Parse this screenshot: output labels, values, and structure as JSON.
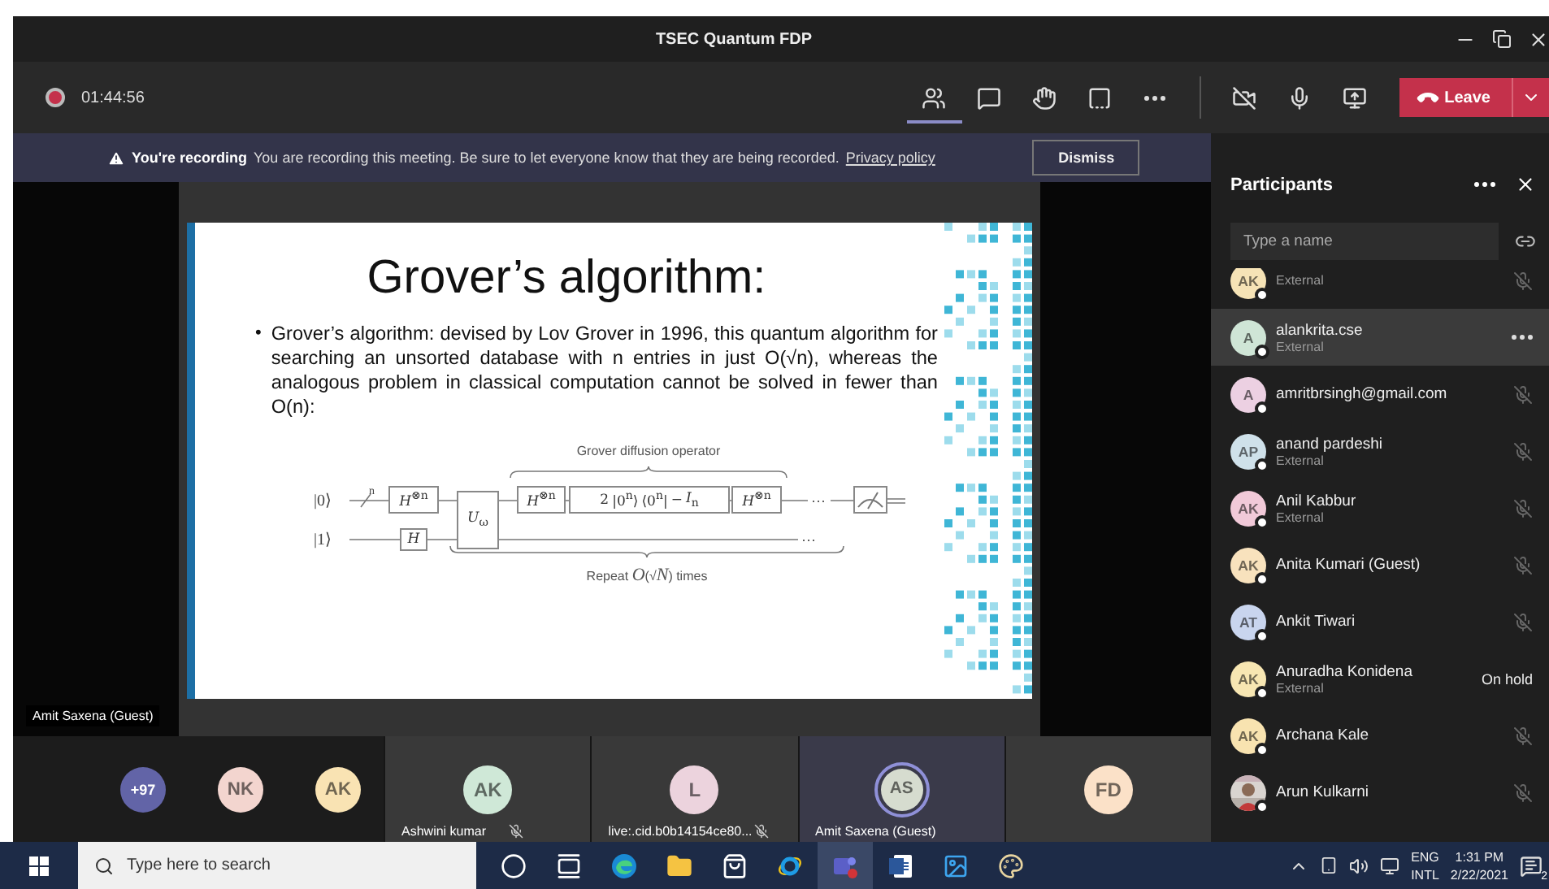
{
  "window": {
    "title": "TSEC Quantum FDP"
  },
  "meeting_bar": {
    "recording": true,
    "duration": "01:44:56",
    "tools": [
      {
        "kind": "participants",
        "selected": true
      },
      {
        "kind": "chat",
        "selected": false
      },
      {
        "kind": "hand",
        "selected": false
      },
      {
        "kind": "rooms",
        "selected": false
      },
      {
        "kind": "more",
        "selected": false
      }
    ],
    "leave_button": "Leave"
  },
  "recording_banner": {
    "title": "You're recording",
    "message": "You are recording this meeting. Be sure to let everyone know that they are being recorded.",
    "link": "Privacy policy",
    "button": "Dismiss"
  },
  "slide": {
    "title": "Grover’s algorithm:",
    "bullets": [
      {
        "marker": "•",
        "text": "Grover’s algorithm: devised by Lov Grover in 1996, this quantum algorithm for searching an unsorted database with n entries in just O(√n), whereas the analogous problem in classical computation cannot be solved in fewer than O(n):"
      }
    ],
    "circuit": {
      "top_label": "Grover diffusion operator",
      "bottom_label": "Repeat *O*(√*N*) times",
      "inputs": [
        "|0⟩",
        "|1⟩"
      ],
      "register_size": "n",
      "continuations": [
        "⋯",
        "⋯"
      ],
      "gates": [
        "*H*$^{⊗n}$",
        "*H*",
        "*U*$_{ω}$",
        "*H*$^{⊗n}$",
        "2 |0$^{n}$⟩ ⟨0$^{n}$| − *I*$_{n}$",
        "*H*$^{⊗n}$"
      ]
    }
  },
  "stage": {
    "presenter": "Amit Saxena (Guest)"
  },
  "participants": {
    "title": "Participants",
    "search": {
      "placeholder": "Type a name"
    },
    "rows": [
      {
        "initials": "AK",
        "color": "#f6e3b6",
        "subtitle": "External",
        "trailing": {
          "kind": "muted"
        },
        "selected": false
      },
      {
        "initials": "A",
        "color": "#cfe5d6",
        "name": "alankrita.cse",
        "subtitle": "External",
        "trailing": {
          "kind": "menu"
        },
        "selected": true
      },
      {
        "initials": "A",
        "color": "#ecd0e2",
        "name": "amritbrsingh@gmail.com",
        "trailing": {
          "kind": "muted"
        },
        "selected": false
      },
      {
        "initials": "AP",
        "color": "#cfe1ea",
        "name": "anand pardeshi",
        "subtitle": "External",
        "trailing": {
          "kind": "muted"
        },
        "selected": false
      },
      {
        "initials": "AK",
        "color": "#f1c9d8",
        "name": "Anil Kabbur",
        "subtitle": "External",
        "trailing": {
          "kind": "muted"
        },
        "selected": false
      },
      {
        "initials": "AK",
        "color": "#f8e2bd",
        "name": "Anita Kumari (Guest)",
        "trailing": {
          "kind": "muted"
        },
        "selected": false
      },
      {
        "initials": "AT",
        "color": "#c9d5ee",
        "name": "Ankit Tiwari",
        "trailing": {
          "kind": "muted"
        },
        "selected": false
      },
      {
        "initials": "AK",
        "color": "#f7e6b2",
        "name": "Anuradha Konidena",
        "subtitle": "External",
        "trailing": {
          "kind": "status",
          "text": "On hold"
        },
        "selected": false
      },
      {
        "initials": "AK",
        "color": "#f8e3b0",
        "name": "Archana Kale",
        "trailing": {
          "kind": "muted"
        },
        "selected": false
      },
      {
        "kind": "picture",
        "name": "Arun Kulkarni",
        "trailing": {
          "kind": "muted"
        },
        "selected": false
      }
    ]
  },
  "gallery": {
    "overflow_count": "+97",
    "avatars": [
      {
        "initials": "NK",
        "color": "#f3d5cf"
      },
      {
        "initials": "AK",
        "color": "#f9e3b3"
      }
    ],
    "tiles": [
      {
        "initials": "AK",
        "color": "#cfe8d7",
        "name": "Ashwini kumar",
        "muted": true,
        "speaking": false
      },
      {
        "initials": "L",
        "color": "#ecd3dd",
        "name": "live:.cid.b0b14154ce80...",
        "muted": true,
        "speaking": false
      },
      {
        "initials": "AS",
        "color": "#d6dccf",
        "name": "Amit Saxena (Guest)",
        "muted": false,
        "speaking": true
      },
      {
        "initials": "FD",
        "color": "#fbe1c8",
        "muted": false,
        "speaking": false
      }
    ]
  },
  "taskbar": {
    "search": {
      "placeholder": "Type here to search"
    },
    "apps": [
      {
        "kind": "cortana",
        "active": false
      },
      {
        "kind": "taskview",
        "active": false
      },
      {
        "kind": "edge",
        "active": false
      },
      {
        "kind": "explorer",
        "active": false
      },
      {
        "kind": "store",
        "active": false
      },
      {
        "kind": "ie",
        "active": false
      },
      {
        "kind": "teams",
        "active": true
      },
      {
        "kind": "word",
        "active": false
      },
      {
        "kind": "photos",
        "active": false
      },
      {
        "kind": "paint",
        "active": false
      }
    ],
    "language": [
      "ENG",
      "INTL"
    ],
    "time": "1:31 PM",
    "date": "2/22/2021",
    "notifications": "2"
  }
}
